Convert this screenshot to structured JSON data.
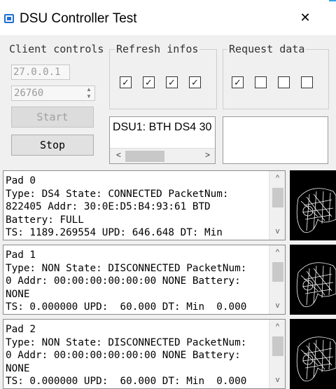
{
  "window": {
    "title": "DSU Controller Test",
    "close_glyph": "✕"
  },
  "client_controls": {
    "label": "Client controls",
    "ip_value": "27.0.0.1",
    "port_value": "26760",
    "start_label": "Start",
    "stop_label": "Stop"
  },
  "refresh_infos": {
    "label": "Refresh infos",
    "checks": [
      true,
      true,
      true,
      true
    ]
  },
  "request_data": {
    "label": "Request data",
    "checks": [
      true,
      false,
      false,
      false
    ]
  },
  "status": {
    "text": "DSU1: BTH DS4 30"
  },
  "scroll_arrows": {
    "left": "<",
    "right": ">",
    "up": "^",
    "down": "v"
  },
  "pads": [
    {
      "lines": [
        "Pad 0",
        "Type: DS4 State: CONNECTED PacketNum:",
        "822405 Addr: 30:0E:D5:B4:93:61 BTD",
        "Battery: FULL",
        "TS: 1189.269554 UPD: 646.648 DT: Min"
      ]
    },
    {
      "lines": [
        "Pad 1",
        "Type: NON State: DISCONNECTED PacketNum:",
        "0 Addr: 00:00:00:00:00:00 NONE Battery:",
        "NONE",
        "TS: 0.000000 UPD:  60.000 DT: Min  0.000"
      ]
    },
    {
      "lines": [
        "Pad 2",
        "Type: NON State: DISCONNECTED PacketNum:",
        "0 Addr: 00:00:00:00:00:00 NONE Battery:",
        "NONE",
        "TS: 0.000000 UPD:  60.000 DT: Min  0.000"
      ]
    }
  ],
  "colors": {
    "accent": "#1f6fd1",
    "window_bg": "#f0f0f0",
    "text": "#000000"
  },
  "icons": [
    "app-icon",
    "close-icon",
    "checkmark-icon",
    "scroll-arrow-icon",
    "controller-wireframe-icon"
  ]
}
